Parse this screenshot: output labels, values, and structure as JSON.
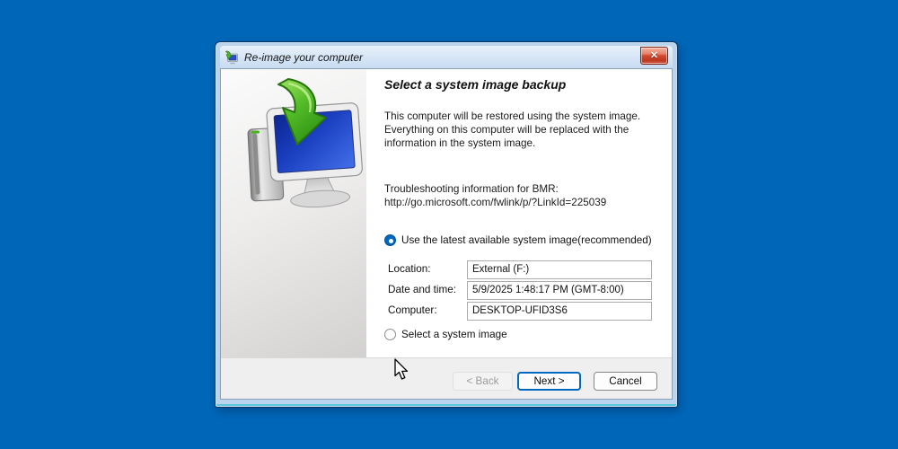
{
  "window": {
    "title": "Re-image your computer",
    "icons": {
      "titlebar": "reimage-computer-icon",
      "close": "close-icon",
      "illustration": "computer-restore-illustration"
    }
  },
  "content": {
    "heading": "Select a system image backup",
    "description_lines": [
      "This computer will be restored using the system image.",
      "Everything on this computer will be replaced with the",
      "information in the system image."
    ],
    "troubleshooting_lines": [
      "Troubleshooting information for BMR:",
      "http://go.microsoft.com/fwlink/p/?LinkId=225039"
    ],
    "radio_latest": {
      "label": "Use the latest available system image(recommended)",
      "selected": true
    },
    "radio_select": {
      "label": "Select a system image",
      "selected": false
    },
    "fields": [
      {
        "label": "Location:",
        "value": "External (F:)"
      },
      {
        "label": "Date and time:",
        "value": "5/9/2025 1:48:17 PM (GMT-8:00)"
      },
      {
        "label": "Computer:",
        "value": "DESKTOP-UFID3S6"
      }
    ]
  },
  "footer": {
    "back_label": "< Back",
    "next_label": "Next >",
    "cancel_label": "Cancel"
  },
  "colors": {
    "desktop_background": "#0067b8",
    "frame": "#b9d4ec",
    "frame_outline": "#0b3464",
    "frame_accent": "#5ac8dc",
    "footer_background": "#efefef",
    "selected_radio": "#0067c0",
    "next_button_border": "#0067c0",
    "close_button_red": "#d14a30"
  }
}
